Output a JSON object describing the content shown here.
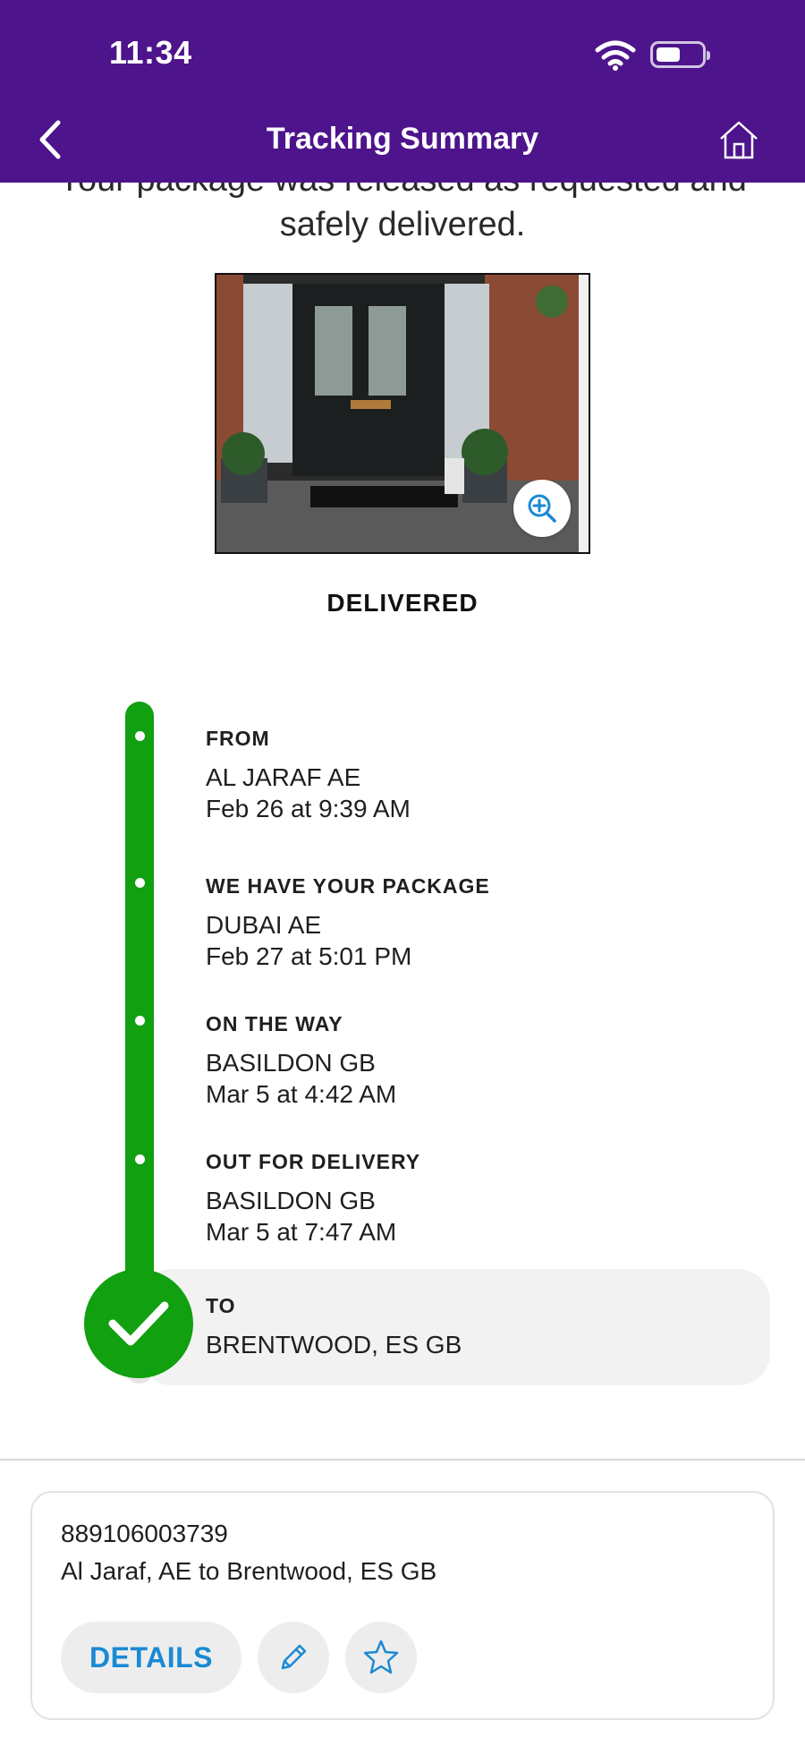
{
  "status_bar": {
    "time": "11:34"
  },
  "header": {
    "title": "Tracking Summary"
  },
  "message": {
    "line1": "Your package was released as requested and",
    "line2": "safely delivered."
  },
  "status_label": "DELIVERED",
  "timeline": [
    {
      "label": "FROM",
      "location": "AL JARAF AE",
      "time": "Feb 26 at 9:39 AM"
    },
    {
      "label": "WE HAVE YOUR PACKAGE",
      "location": "DUBAI AE",
      "time": "Feb 27 at 5:01 PM"
    },
    {
      "label": "ON THE WAY",
      "location": "BASILDON GB",
      "time": "Mar 5 at 4:42 AM"
    },
    {
      "label": "OUT FOR DELIVERY",
      "location": "BASILDON GB",
      "time": "Mar 5 at 7:47 AM"
    },
    {
      "label": "TO",
      "location": "BRENTWOOD, ES  GB"
    }
  ],
  "shipment": {
    "tracking_number": "889106003739",
    "route": "Al Jaraf, AE to Brentwood, ES GB",
    "details_label": "DETAILS"
  },
  "colors": {
    "header": "#4d148c",
    "timeline": "#10a010",
    "link": "#1a8ad4"
  },
  "icons": [
    "back-chevron-icon",
    "home-icon",
    "zoom-in-icon",
    "checkmark-icon",
    "pencil-icon",
    "star-icon",
    "wifi-icon",
    "battery-icon"
  ]
}
